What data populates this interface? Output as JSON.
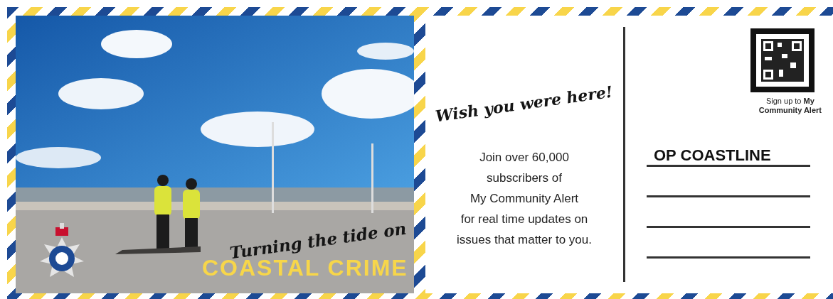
{
  "tagline": "Turning the tide on",
  "headline": "COASTAL CRIME",
  "greeting": "Wish you were here!",
  "message": [
    "Join over 60,000",
    "subscribers of",
    "My Community Alert",
    "for real time updates on",
    "issues that matter to you."
  ],
  "qr_caption": [
    "Sign up to **My**",
    "**Community Alert**"
  ],
  "address_title": "OP COASTLINE"
}
